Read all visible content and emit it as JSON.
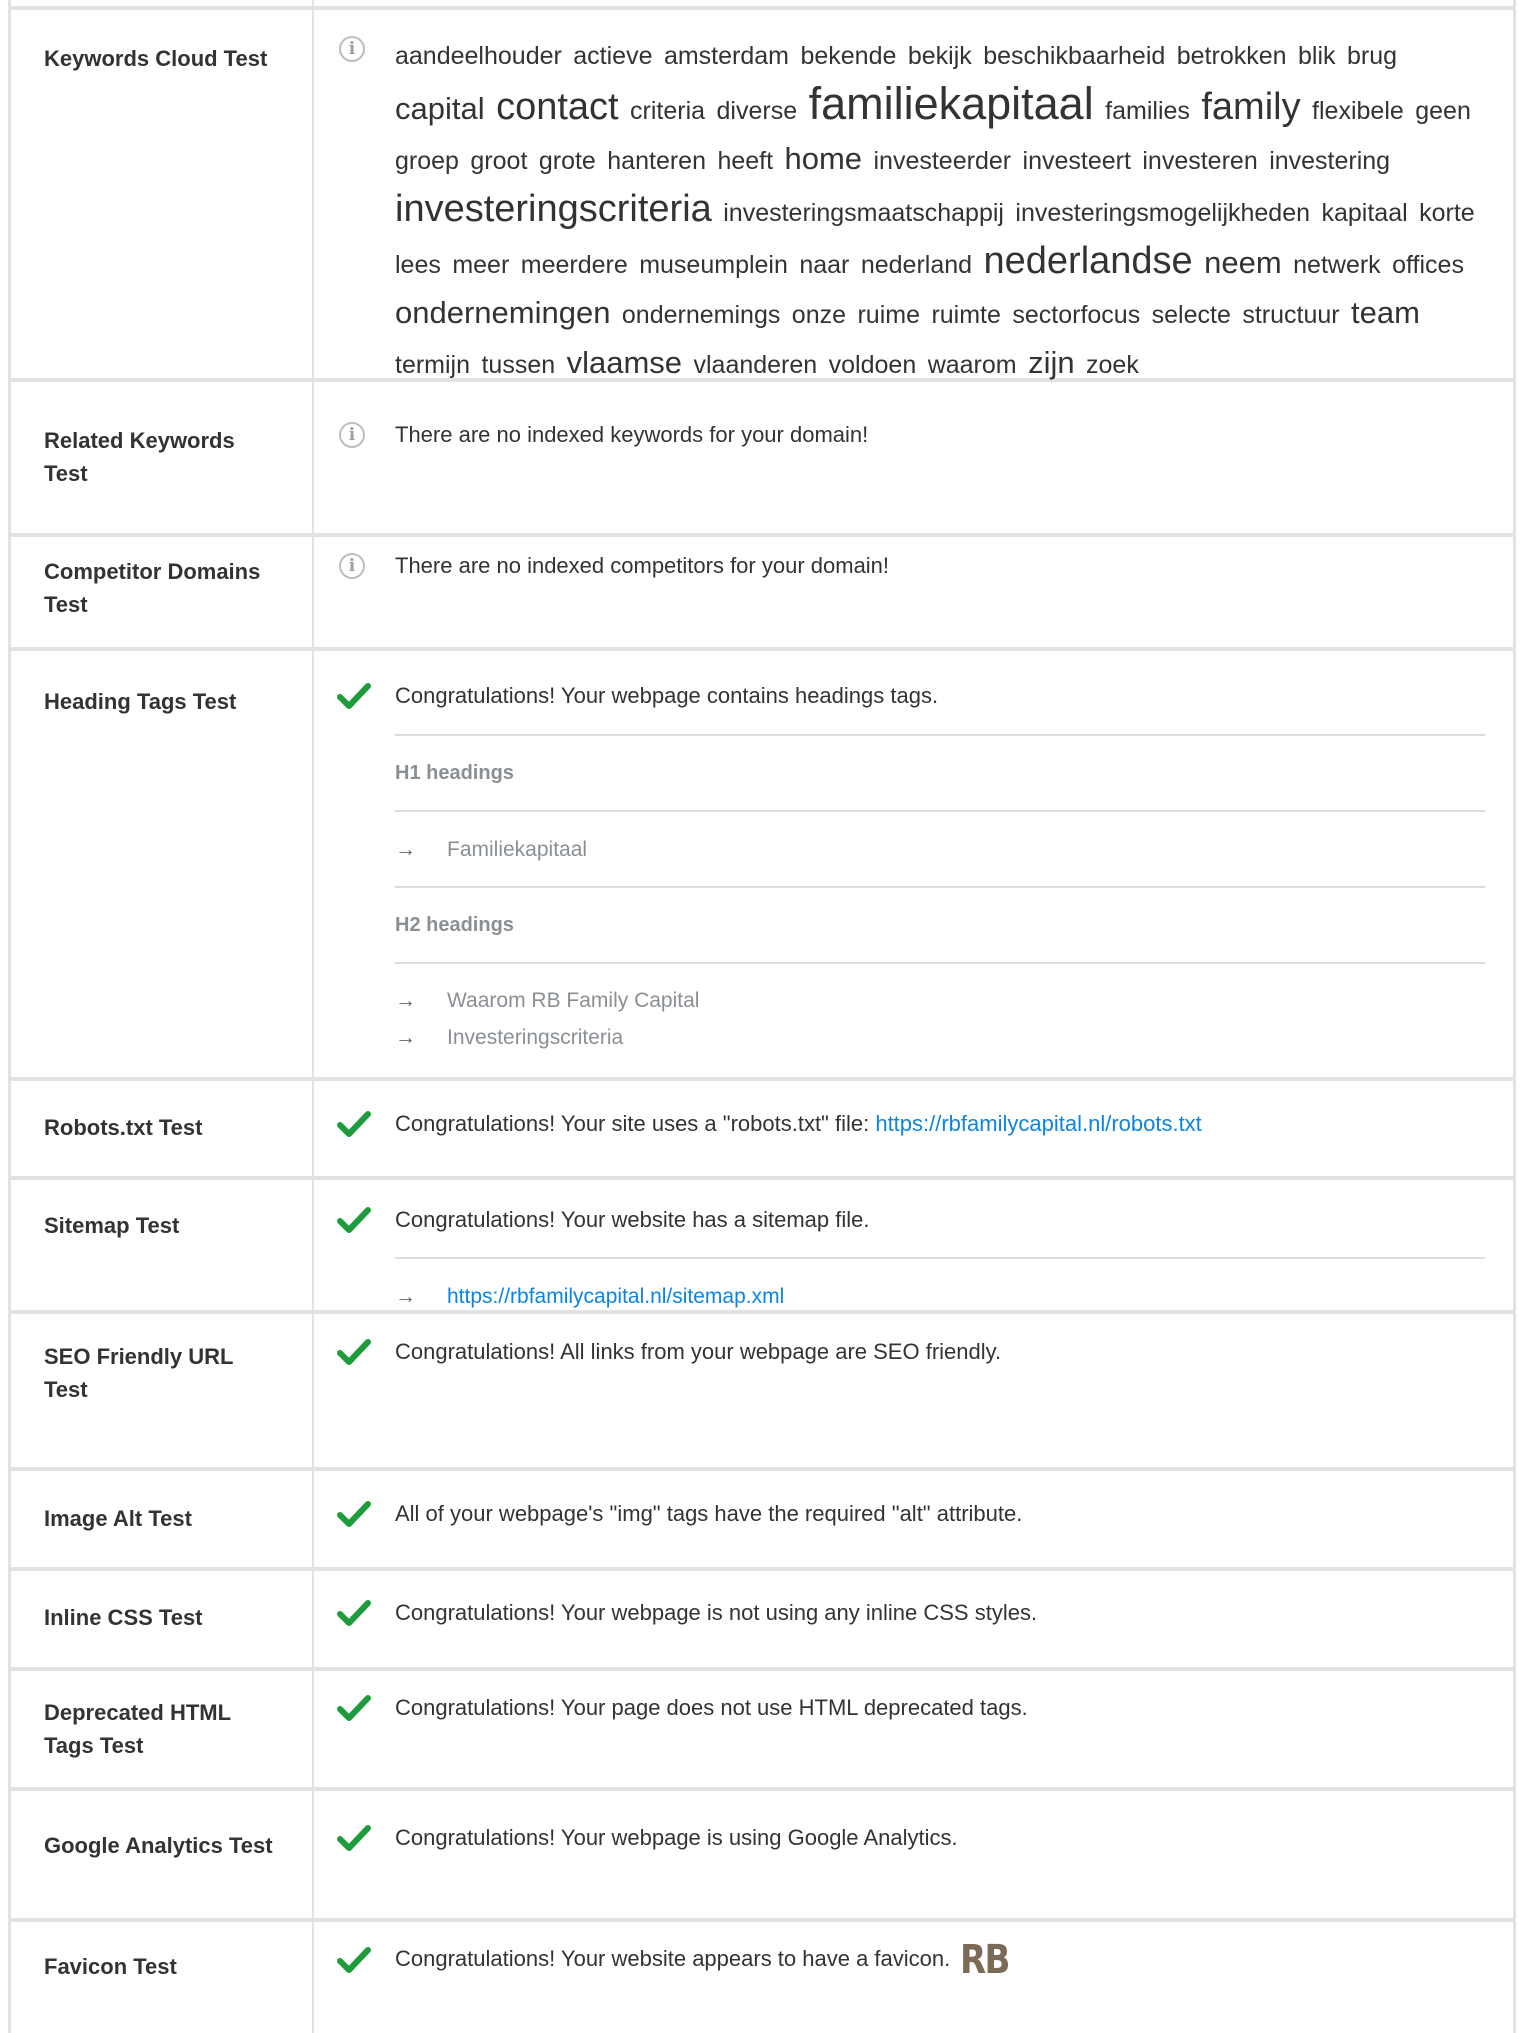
{
  "colors": {
    "check": "#1e9b3a",
    "link": "#0d84e0",
    "info": "#9e9e9e"
  },
  "keywords_cloud": {
    "label": "Keywords Cloud Test",
    "words": [
      {
        "w": "aandeelhouder",
        "s": 1
      },
      {
        "w": "actieve",
        "s": 1
      },
      {
        "w": "amsterdam",
        "s": 1
      },
      {
        "w": "bekende",
        "s": 1
      },
      {
        "w": "bekijk",
        "s": 1
      },
      {
        "w": "beschikbaarheid",
        "s": 1
      },
      {
        "w": "betrokken",
        "s": 1
      },
      {
        "w": "blik",
        "s": 1
      },
      {
        "w": "brug",
        "s": 1
      },
      {
        "w": "capital",
        "s": 2
      },
      {
        "w": "contact",
        "s": 3
      },
      {
        "w": "criteria",
        "s": 1
      },
      {
        "w": "diverse",
        "s": 1
      },
      {
        "w": "familiekapitaal",
        "s": 4
      },
      {
        "w": "families",
        "s": 1
      },
      {
        "w": "family",
        "s": 3
      },
      {
        "w": "flexibele",
        "s": 1
      },
      {
        "w": "geen",
        "s": 1
      },
      {
        "w": "groep",
        "s": 1
      },
      {
        "w": "groot",
        "s": 1
      },
      {
        "w": "grote",
        "s": 1
      },
      {
        "w": "hanteren",
        "s": 1
      },
      {
        "w": "heeft",
        "s": 1
      },
      {
        "w": "home",
        "s": 2
      },
      {
        "w": "investeerder",
        "s": 1
      },
      {
        "w": "investeert",
        "s": 1
      },
      {
        "w": "investeren",
        "s": 1
      },
      {
        "w": "investering",
        "s": 1
      },
      {
        "w": "investeringscriteria",
        "s": 3
      },
      {
        "w": "investeringsmaatschappij",
        "s": 1
      },
      {
        "w": "investeringsmogelijkheden",
        "s": 1
      },
      {
        "w": "kapitaal",
        "s": 1
      },
      {
        "w": "korte",
        "s": 1
      },
      {
        "w": "lees",
        "s": 1
      },
      {
        "w": "meer",
        "s": 1
      },
      {
        "w": "meerdere",
        "s": 1
      },
      {
        "w": "museumplein",
        "s": 1
      },
      {
        "w": "naar",
        "s": 1
      },
      {
        "w": "nederland",
        "s": 1
      },
      {
        "w": "nederlandse",
        "s": 3
      },
      {
        "w": "neem",
        "s": 2
      },
      {
        "w": "netwerk",
        "s": 1
      },
      {
        "w": "offices",
        "s": 1
      },
      {
        "w": "ondernemingen",
        "s": 2
      },
      {
        "w": "ondernemings",
        "s": 1
      },
      {
        "w": "onze",
        "s": 1
      },
      {
        "w": "ruime",
        "s": 1
      },
      {
        "w": "ruimte",
        "s": 1
      },
      {
        "w": "sectorfocus",
        "s": 1
      },
      {
        "w": "selecte",
        "s": 1
      },
      {
        "w": "structuur",
        "s": 1
      },
      {
        "w": "team",
        "s": 2
      },
      {
        "w": "termijn",
        "s": 1
      },
      {
        "w": "tussen",
        "s": 1
      },
      {
        "w": "vlaamse",
        "s": 2
      },
      {
        "w": "vlaanderen",
        "s": 1
      },
      {
        "w": "voldoen",
        "s": 1
      },
      {
        "w": "waarom",
        "s": 1
      },
      {
        "w": "zijn",
        "s": 2
      },
      {
        "w": "zoek",
        "s": 1
      }
    ]
  },
  "related_keywords": {
    "label": "Related Keywords Test",
    "message": "There are no indexed keywords for your domain!"
  },
  "competitor_domains": {
    "label": "Competitor Domains Test",
    "message": "There are no indexed competitors for your domain!"
  },
  "heading_tags": {
    "label": "Heading Tags Test",
    "message": "Congratulations! Your webpage contains headings tags.",
    "h1_title": "H1 headings",
    "h1_items": [
      "Familiekapitaal"
    ],
    "h2_title": "H2 headings",
    "h2_items": [
      "Waarom RB Family Capital",
      "Investeringscriteria"
    ]
  },
  "robots": {
    "label": "Robots.txt Test",
    "message": "Congratulations! Your site uses a \"robots.txt\" file: ",
    "link": "https://rbfamilycapital.nl/robots.txt"
  },
  "sitemap": {
    "label": "Sitemap Test",
    "message": "Congratulations! Your website has a sitemap file.",
    "link": "https://rbfamilycapital.nl/sitemap.xml"
  },
  "seo_friendly": {
    "label": "SEO Friendly URL Test",
    "message": "Congratulations! All links from your webpage are SEO friendly."
  },
  "image_alt": {
    "label": "Image Alt Test",
    "message": "All of your webpage's \"img\" tags have the required \"alt\" attribute."
  },
  "inline_css": {
    "label": "Inline CSS Test",
    "message": "Congratulations! Your webpage is not using any inline CSS styles."
  },
  "deprecated_html": {
    "label": "Deprecated HTML Tags Test",
    "message": "Congratulations! Your page does not use HTML deprecated tags."
  },
  "google_analytics": {
    "label": "Google Analytics Test",
    "message": "Congratulations! Your webpage is using Google Analytics."
  },
  "favicon": {
    "label": "Favicon Test",
    "message": "Congratulations! Your website appears to have a favicon.",
    "favicon_text": "RB"
  },
  "icons": {
    "info": "info-icon",
    "check": "checkmark-icon",
    "arrow": "arrow-right-icon"
  }
}
